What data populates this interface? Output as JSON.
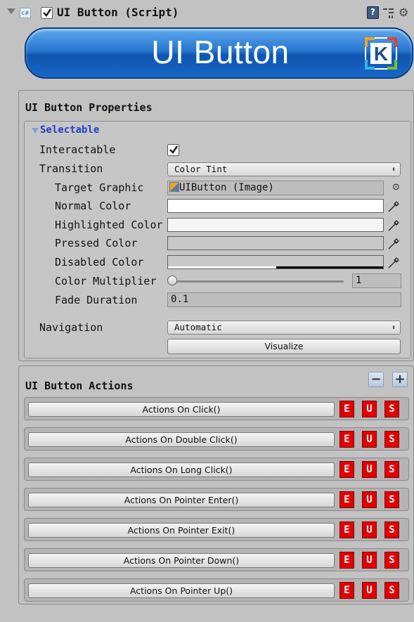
{
  "header": {
    "title": "UI Button (Script)",
    "enabled": true,
    "icons": [
      "fold-arrow",
      "csharp-script-icon",
      "help-book-icon",
      "layout-icon",
      "gear-icon"
    ]
  },
  "banner": {
    "title": "UI Button",
    "logo": "K"
  },
  "properties": {
    "title": "UI Button Properties",
    "foldout_label": "Selectable",
    "interactable_label": "Interactable",
    "interactable": true,
    "transition_label": "Transition",
    "transition_value": "Color Tint",
    "target_graphic_label": "Target Graphic",
    "target_graphic_value": "UIButton (Image)",
    "normal_color_label": "Normal Color",
    "normal_color": "#ffffff",
    "highlighted_color_label": "Highlighted Color",
    "highlighted_color": "#f5f5f5",
    "pressed_color_label": "Pressed Color",
    "pressed_color": "#c8c8c8",
    "disabled_color_label": "Disabled Color",
    "disabled_color": "#c8c8c8",
    "color_multiplier_label": "Color Multiplier",
    "color_multiplier_value": "1",
    "fade_duration_label": "Fade Duration",
    "fade_duration_value": "0.1",
    "navigation_label": "Navigation",
    "navigation_value": "Automatic",
    "visualize_label": "Visualize"
  },
  "actions": {
    "title": "UI Button Actions",
    "minus_label": "−",
    "plus_label": "+",
    "eus_labels": [
      "E",
      "U",
      "S"
    ],
    "rows": [
      "Actions On Click()",
      "Actions On Double Click()",
      "Actions On Long Click()",
      "Actions On Pointer Enter()",
      "Actions On Pointer Exit()",
      "Actions On Pointer Down()",
      "Actions On Pointer Up()"
    ]
  },
  "colors": {
    "accent_red": "#e00000",
    "banner_blue": "#1968c5",
    "foldout_blue": "#1f3fc8"
  }
}
